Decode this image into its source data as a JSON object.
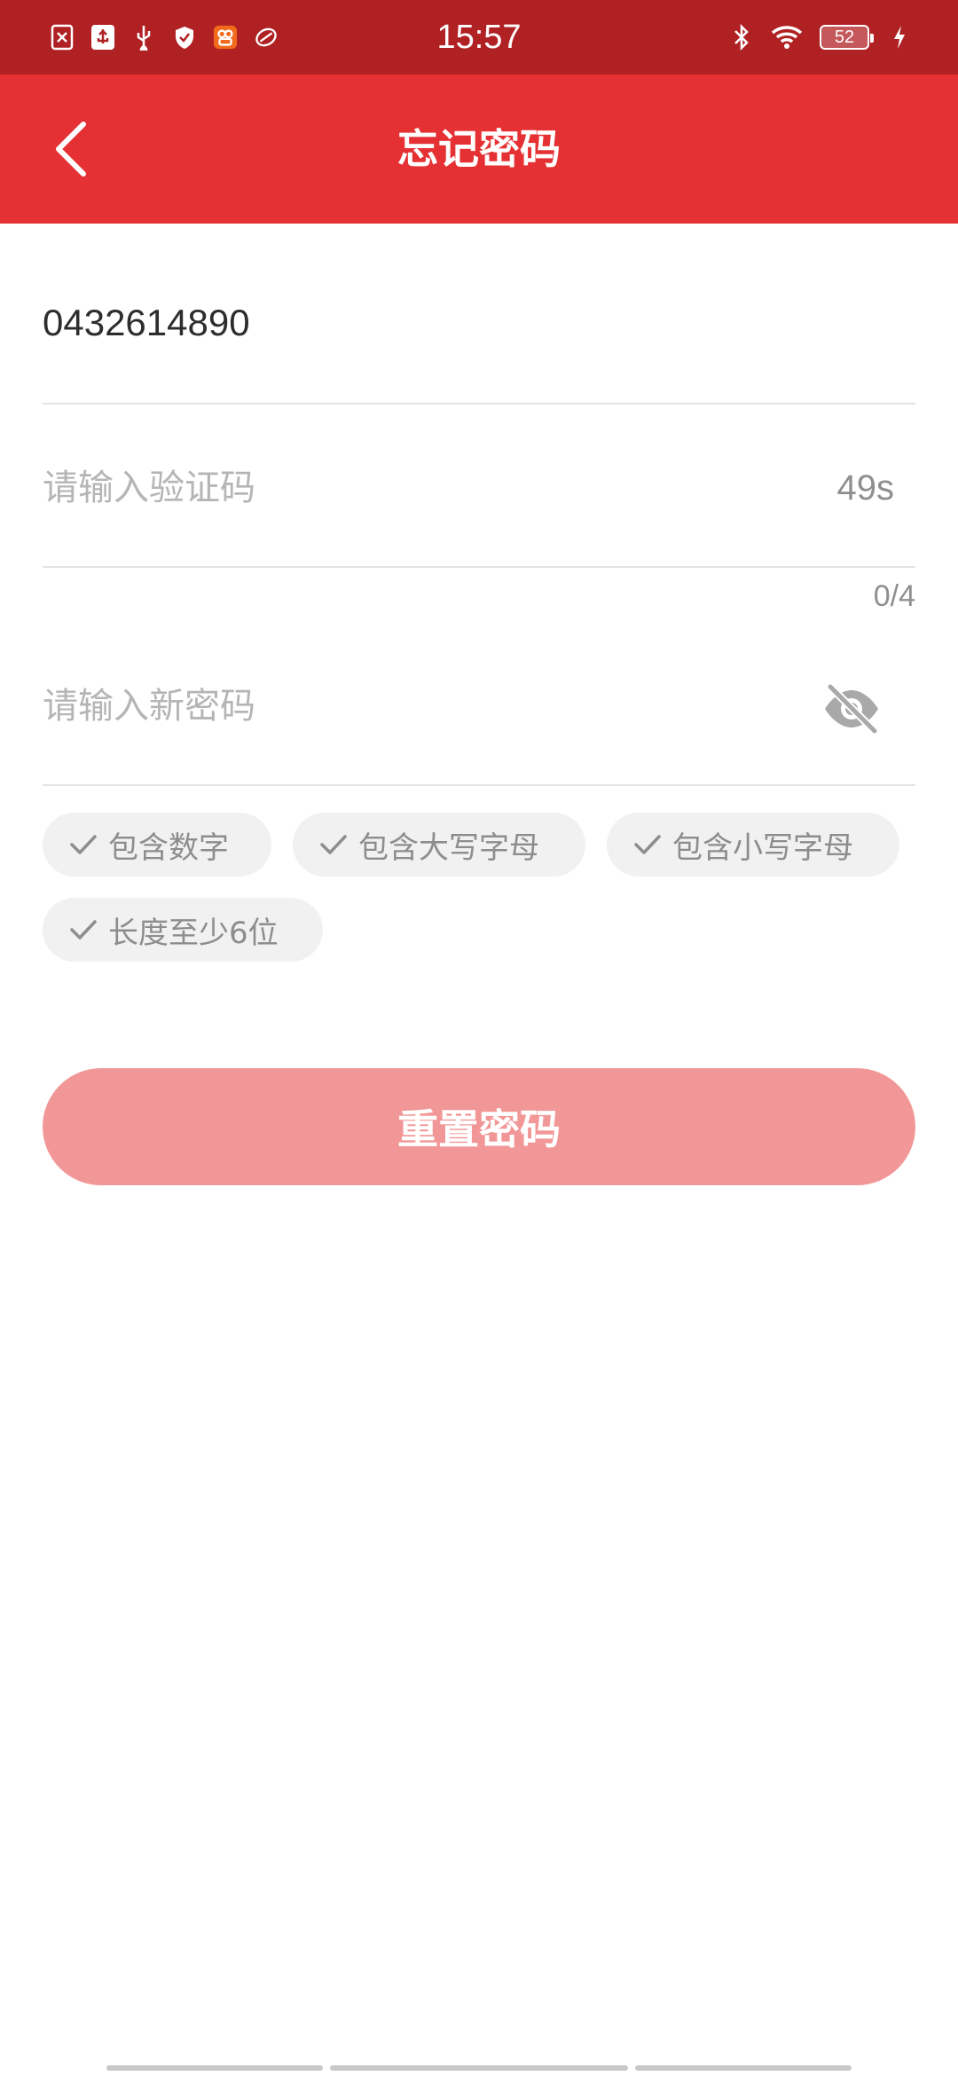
{
  "status_bar": {
    "time": "15:57",
    "battery_level": "52",
    "left_icons": [
      "close-file-icon",
      "usb-debug-icon",
      "usb-icon",
      "shield-icon",
      "app-notification-icon",
      "sync-icon"
    ],
    "right_icons": [
      "bluetooth-icon",
      "wifi-icon",
      "battery-icon",
      "charging-icon"
    ]
  },
  "app_bar": {
    "title": "忘记密码",
    "back_icon": "chevron-left-icon"
  },
  "form": {
    "phone": {
      "value": "0432614890"
    },
    "code": {
      "placeholder": "请输入验证码",
      "countdown": "49s",
      "counter": "0/4"
    },
    "password": {
      "placeholder": "请输入新密码",
      "visibility_icon": "eye-off-icon"
    }
  },
  "requirements": [
    {
      "label": "包含数字"
    },
    {
      "label": "包含大写字母"
    },
    {
      "label": "包含小写字母"
    },
    {
      "label": "长度至少6位"
    }
  ],
  "submit": {
    "label": "重置密码"
  },
  "colors": {
    "status_bar": "#b02124",
    "app_bar": "#e53133",
    "submit_button": "#f29797",
    "chip_bg": "#f1f1f1",
    "placeholder": "#b5b5b5"
  }
}
